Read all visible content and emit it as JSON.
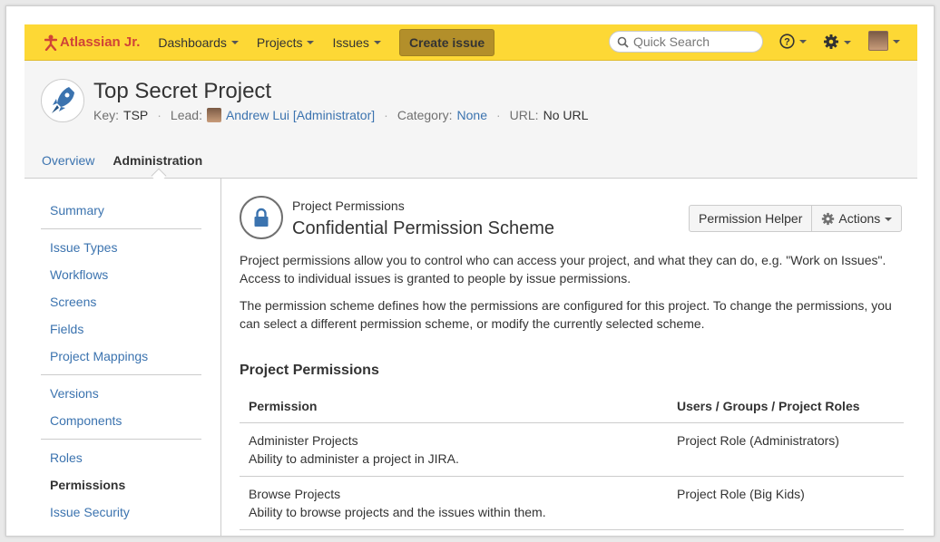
{
  "header": {
    "logo_text": "Atlassian Jr.",
    "nav": [
      "Dashboards",
      "Projects",
      "Issues"
    ],
    "create_label": "Create issue",
    "search_placeholder": "Quick Search",
    "icons": [
      "help-icon",
      "gear-icon",
      "user-avatar"
    ],
    "accent": "#fdd835"
  },
  "project": {
    "name": "Top Secret Project",
    "key_label": "Key:",
    "key": "TSP",
    "lead_label": "Lead:",
    "lead": "Andrew Lui [Administrator]",
    "category_label": "Category:",
    "category": "None",
    "url_label": "URL:",
    "url": "No URL",
    "tabs": [
      "Overview",
      "Administration"
    ]
  },
  "sidebar": {
    "items": [
      "Summary",
      "Issue Types",
      "Workflows",
      "Screens",
      "Fields",
      "Project Mappings",
      "Versions",
      "Components",
      "Roles",
      "Permissions",
      "Issue Security"
    ],
    "active": "Permissions"
  },
  "main": {
    "kicker": "Project Permissions",
    "title": "Confidential Permission Scheme",
    "helper_button": "Permission Helper",
    "actions_button": "Actions",
    "desc1": "Project permissions allow you to control who can access your project, and what they can do, e.g. \"Work on Issues\". Access to individual issues is granted to people by issue permissions.",
    "desc2": "The permission scheme defines how the permissions are configured for this project. To change the permissions, you can select a different permission scheme, or modify the currently selected scheme.",
    "section_title": "Project Permissions",
    "table": {
      "columns": [
        "Permission",
        "Users / Groups / Project Roles"
      ],
      "rows": [
        {
          "name": "Administer Projects",
          "desc": "Ability to administer a project in JIRA.",
          "grant": "Project Role (Administrators)"
        },
        {
          "name": "Browse Projects",
          "desc": "Ability to browse projects and the issues within them.",
          "grant": "Project Role (Big Kids)"
        }
      ]
    }
  }
}
